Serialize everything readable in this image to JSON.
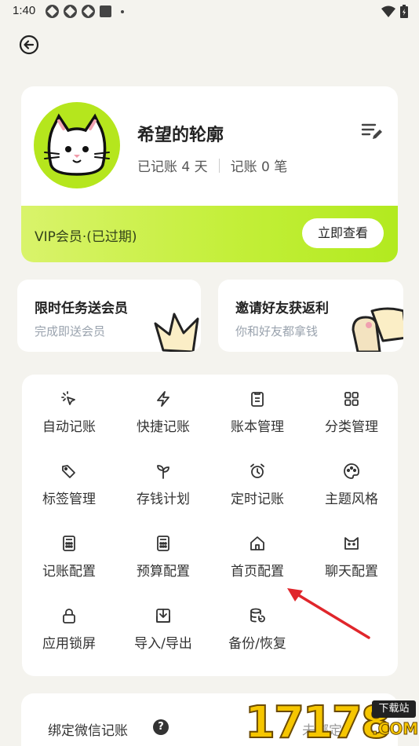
{
  "status_bar": {
    "time": "1:40"
  },
  "profile": {
    "username": "希望的轮廓",
    "days_label": "已记账 4 天",
    "records_label": "记账 0 笔",
    "vip_status": "VIP会员·(已过期)",
    "vip_button": "立即查看"
  },
  "promos": [
    {
      "title": "限时任务送会员",
      "subtitle": "完成即送会员"
    },
    {
      "title": "邀请好友获返利",
      "subtitle": "你和好友都拿钱"
    }
  ],
  "features": [
    {
      "label": "自动记账",
      "icon": "cursor-click-icon"
    },
    {
      "label": "快捷记账",
      "icon": "lightning-icon"
    },
    {
      "label": "账本管理",
      "icon": "clipboard-icon"
    },
    {
      "label": "分类管理",
      "icon": "grid-icon"
    },
    {
      "label": "标签管理",
      "icon": "tag-icon"
    },
    {
      "label": "存钱计划",
      "icon": "sprout-icon"
    },
    {
      "label": "定时记账",
      "icon": "alarm-clock-icon"
    },
    {
      "label": "主题风格",
      "icon": "palette-icon"
    },
    {
      "label": "记账配置",
      "icon": "calculator-icon"
    },
    {
      "label": "预算配置",
      "icon": "calculator-icon"
    },
    {
      "label": "首页配置",
      "icon": "home-icon"
    },
    {
      "label": "聊天配置",
      "icon": "cat-face-icon"
    },
    {
      "label": "应用锁屏",
      "icon": "lock-icon"
    },
    {
      "label": "导入/导出",
      "icon": "import-export-icon"
    },
    {
      "label": "备份/恢复",
      "icon": "database-restore-icon"
    }
  ],
  "bind_wechat": {
    "label": "绑定微信记账",
    "status": "未绑定"
  },
  "watermark": {
    "number": "17178",
    "tag": "下载站",
    "domain": ".COM"
  },
  "colors": {
    "accent_green": "#b5e61d",
    "arrow_red": "#e0262b"
  }
}
